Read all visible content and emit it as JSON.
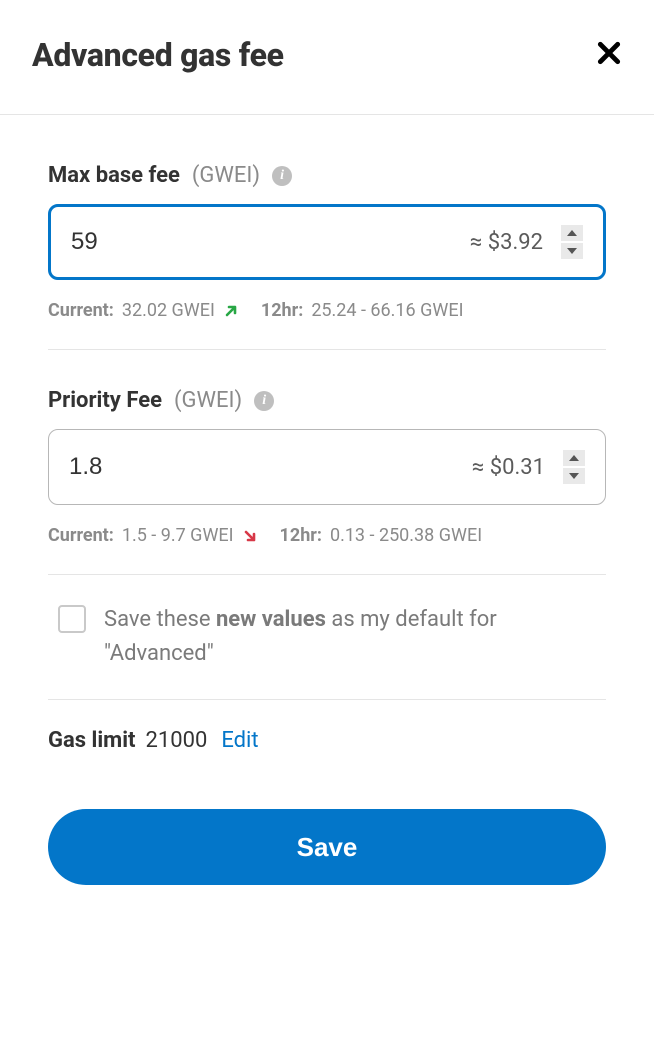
{
  "header": {
    "title": "Advanced gas fee"
  },
  "maxBaseFee": {
    "label": "Max base fee",
    "unit": "(GWEI)",
    "value": "59",
    "usd": "≈ $3.92",
    "current_label": "Current:",
    "current_value": "32.02 GWEI",
    "twelvehr_label": "12hr:",
    "twelvehr_value": "25.24 - 66.16 GWEI"
  },
  "priorityFee": {
    "label": "Priority Fee",
    "unit": "(GWEI)",
    "value": "1.8",
    "usd": "≈ $0.31",
    "current_label": "Current:",
    "current_value": "1.5 - 9.7 GWEI",
    "twelvehr_label": "12hr:",
    "twelvehr_value": "0.13 - 250.38 GWEI"
  },
  "saveDefault": {
    "pre": "Save these ",
    "bold": "new values",
    "post": " as my default for \"Advanced\""
  },
  "gasLimit": {
    "label": "Gas limit",
    "value": "21000",
    "edit": "Edit"
  },
  "actions": {
    "save": "Save"
  },
  "colors": {
    "accent": "#0376c9",
    "up": "#28a745",
    "down": "#d73847"
  }
}
